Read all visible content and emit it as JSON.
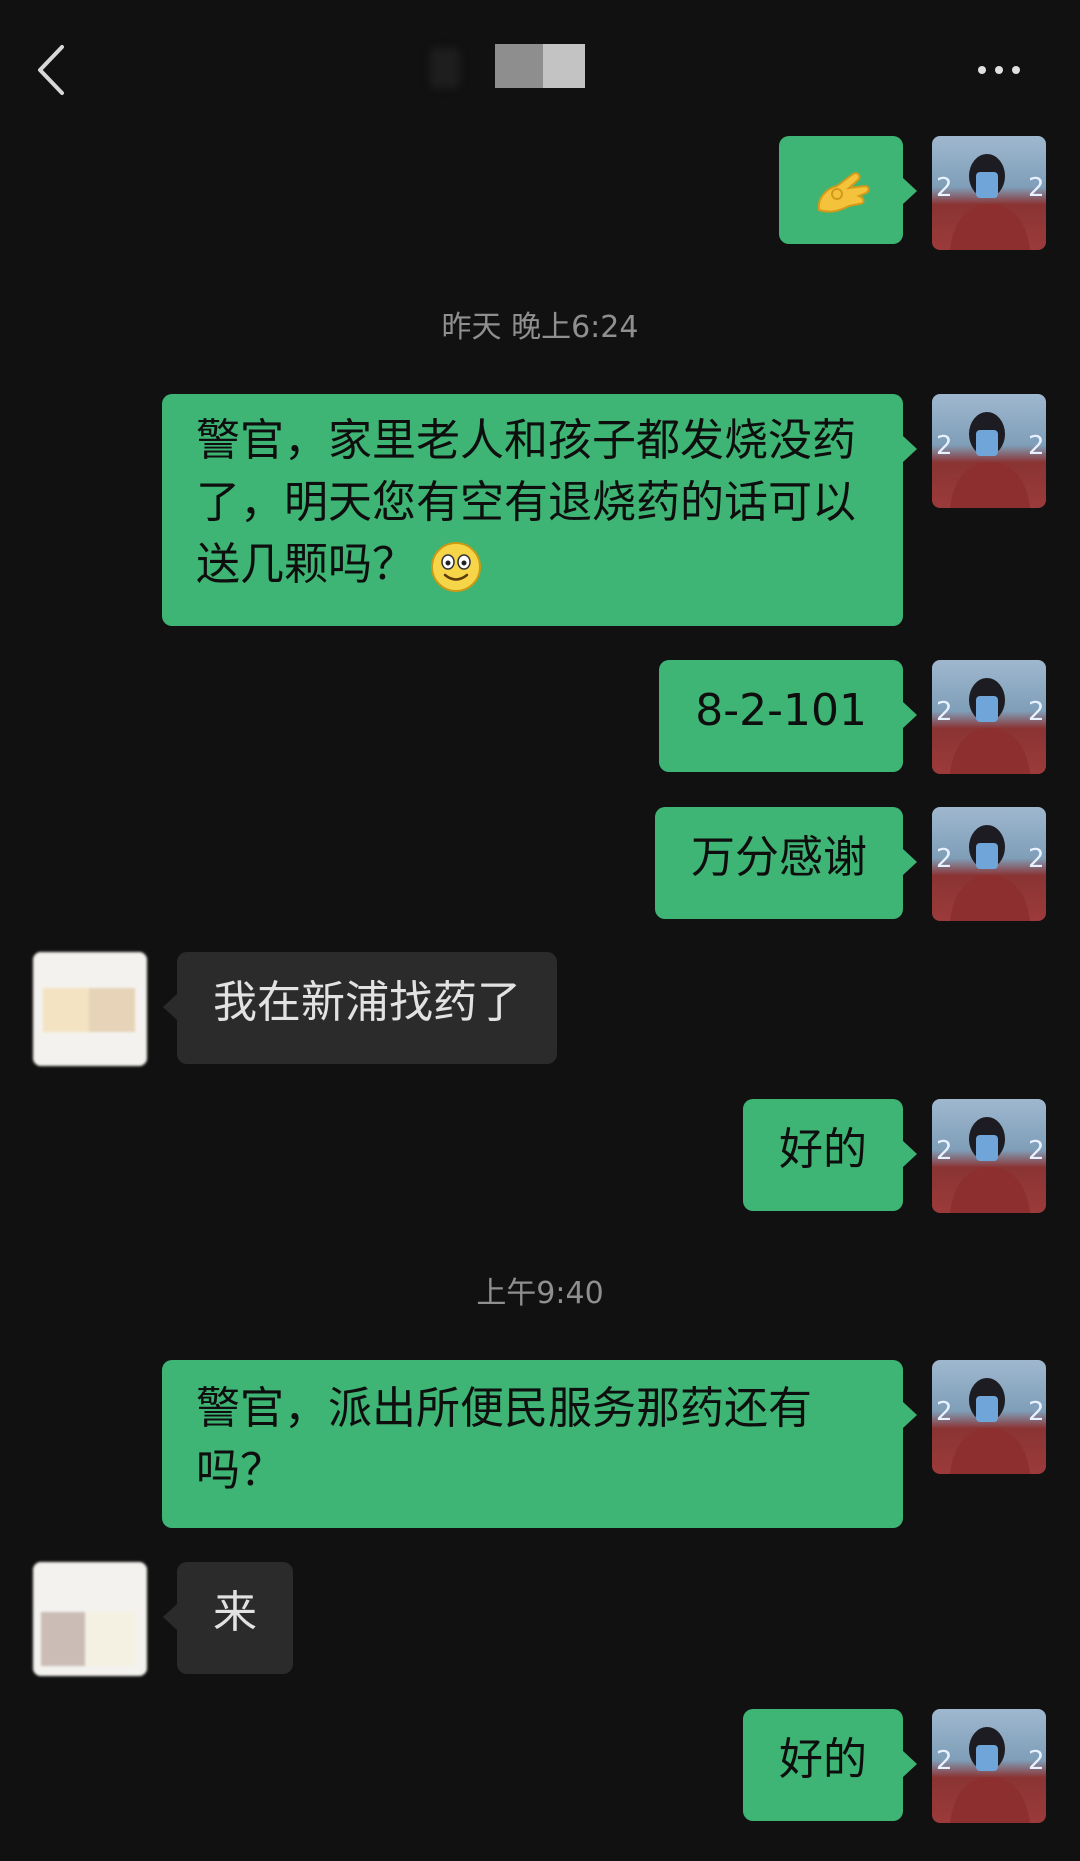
{
  "header": {
    "back_icon": "chevron-left-icon",
    "title": "",
    "more_icon": "more-dots-icon"
  },
  "messages": [
    {
      "side": "me",
      "type": "emoji",
      "emoji_name": "ok-hand-emoji"
    },
    {
      "type": "timestamp",
      "text": "昨天 晚上6:24"
    },
    {
      "side": "me",
      "type": "text",
      "text": "警官，家里老人和孩子都发烧没药了，明天您有空有退烧药的话可以送几颗吗？",
      "trailing_emoji": "smile-emoji"
    },
    {
      "side": "me",
      "type": "text",
      "text": "8-2-101"
    },
    {
      "side": "me",
      "type": "text",
      "text": "万分感谢"
    },
    {
      "side": "them",
      "type": "text",
      "text": "我在新浦找药了"
    },
    {
      "side": "me",
      "type": "text",
      "text": "好的"
    },
    {
      "type": "timestamp",
      "text": "上午9:40"
    },
    {
      "side": "me",
      "type": "text",
      "text": "警官，派出所便民服务那药还有吗？"
    },
    {
      "side": "them",
      "type": "text",
      "text": "来"
    },
    {
      "side": "me",
      "type": "text",
      "text": "好的"
    }
  ],
  "colors": {
    "background": "#111111",
    "my_bubble": "#3eb574",
    "their_bubble": "#2b2b2b",
    "timestamp": "#8f8f8f"
  }
}
